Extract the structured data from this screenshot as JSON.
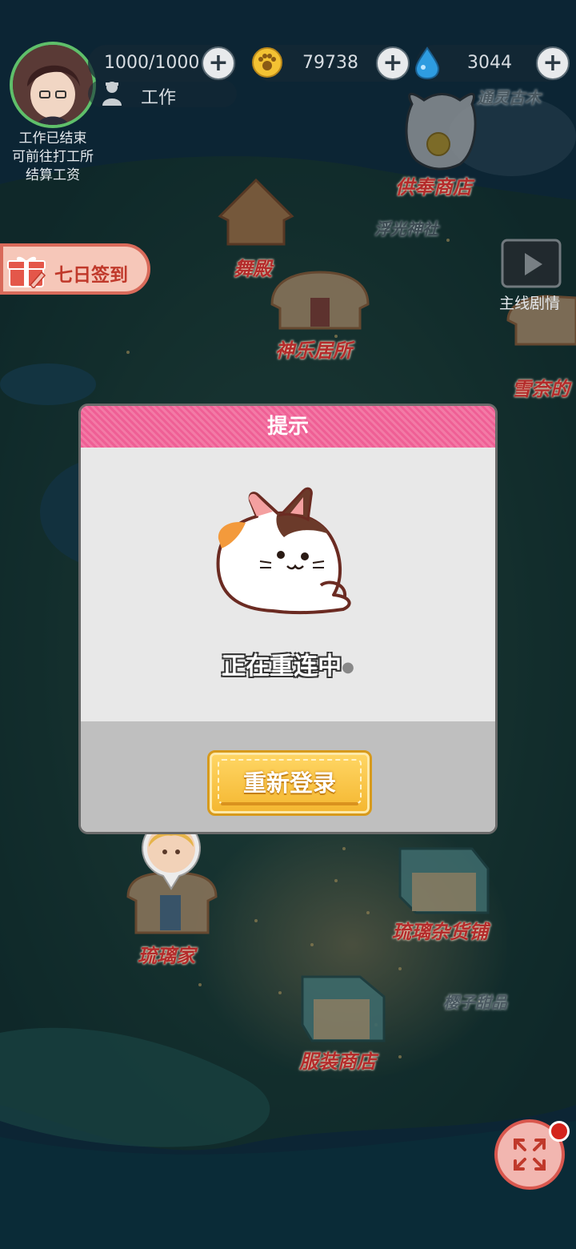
{
  "hud": {
    "energy": "1000/1000",
    "work_label": "工作",
    "coins": "79738",
    "gems": "3044",
    "area_name": "通灵古木",
    "work_note": [
      "工作已结束",
      "可前往打工所",
      "结算工资"
    ]
  },
  "map": {
    "labels": {
      "shop_offering": "供奉商店",
      "shrine": "浮光神社",
      "dance_hall": "舞殿",
      "kagura": "神乐居所",
      "yukina": "雪奈的",
      "ruri_home": "琉璃家",
      "ruri_store": "琉璃杂货铺",
      "sakura_sweets": "樱子甜品",
      "clothing_store": "服装商店"
    }
  },
  "signin": {
    "label": "七日签到"
  },
  "story": {
    "label": "主线剧情"
  },
  "icons": {
    "coin": "paw-coin-icon",
    "gem": "blue-drop-icon",
    "work": "worker-icon",
    "signin": "gift-icon",
    "story": "clapperboard-icon",
    "expand": "expand-arrows-icon"
  },
  "dialog": {
    "title": "提示",
    "message": "正在重连中",
    "button": "重新登录"
  },
  "colors": {
    "header_pink": "#ef5f95",
    "button_yellow": "#f4b62f",
    "map_label_red": "#b42b2b"
  }
}
